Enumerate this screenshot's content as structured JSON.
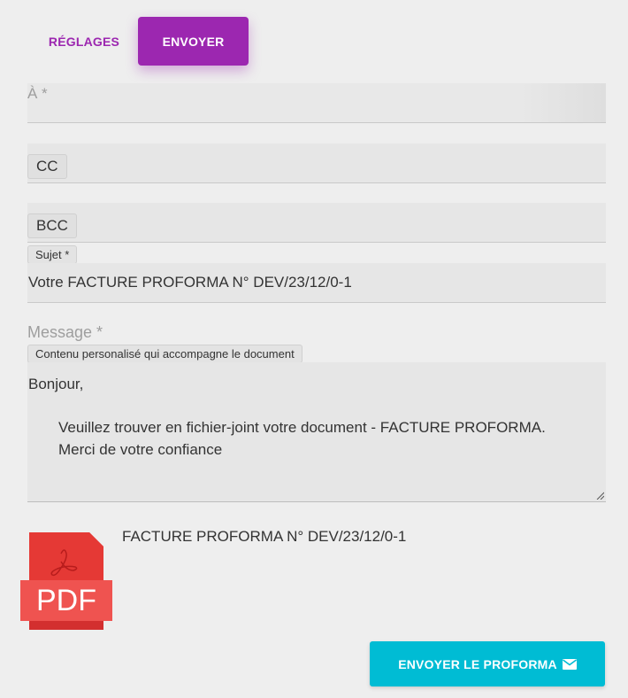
{
  "tabs": [
    {
      "label": "RÉGLAGES",
      "active": false
    },
    {
      "label": "ENVOYER",
      "active": true
    }
  ],
  "form": {
    "to_label": "À *",
    "cc_label": "CC",
    "bcc_label": "BCC",
    "subject_label": "Sujet *",
    "subject_value": "Votre FACTURE PROFORMA N° DEV/23/12/0-1",
    "message_label": "Message *",
    "message_hint": "Contenu personalisé qui accompagne le document",
    "message_lines": [
      "Bonjour,",
      "Veuillez trouver en fichier-joint votre document - FACTURE PROFORMA.",
      "Merci de votre confiance"
    ]
  },
  "attachment": {
    "icon": "pdf-file-icon",
    "badge": "PDF",
    "name": "FACTURE PROFORMA N° DEV/23/12/0-1"
  },
  "send_button": {
    "label": "ENVOYER LE PROFORMA",
    "icon": "mail-icon"
  },
  "colors": {
    "accent": "#9c27b0",
    "button": "#00bcd4",
    "pdf_red": "#e53935",
    "background": "#eeeeee"
  }
}
